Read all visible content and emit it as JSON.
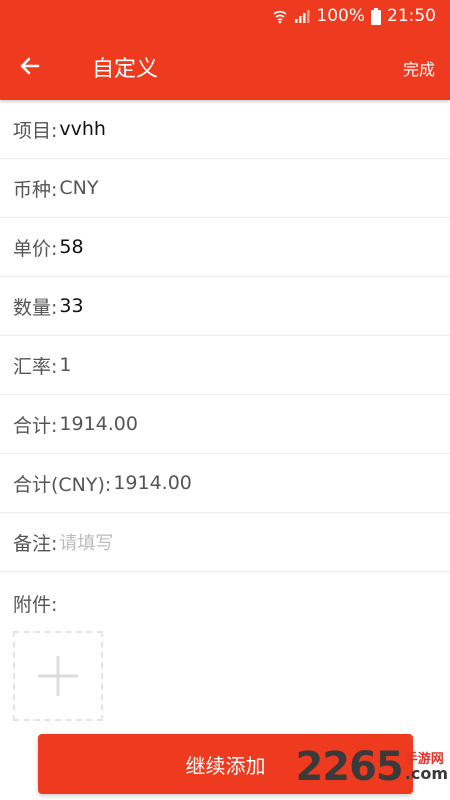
{
  "status_bar": {
    "battery": "100%",
    "time": "21:50",
    "icons": [
      "wifi-icon",
      "signal-icon",
      "battery-icon"
    ]
  },
  "appbar": {
    "back_icon": "arrow-left-icon",
    "title": "自定义",
    "done_label": "完成"
  },
  "form": {
    "item": {
      "label": "项目:",
      "value": "vvhh"
    },
    "currency": {
      "label": "币种:",
      "value": "CNY"
    },
    "unit_price": {
      "label": "单价:",
      "value": "58"
    },
    "quantity": {
      "label": "数量:",
      "value": "33"
    },
    "exchange_rate": {
      "label": "汇率:",
      "value": "1"
    },
    "total": {
      "label": "合计:",
      "value": "1914.00"
    },
    "total_cny": {
      "label": "合计(CNY):",
      "value": "1914.00"
    },
    "note": {
      "label": "备注:",
      "placeholder": "请填写"
    },
    "attachment": {
      "label": "附件:",
      "add_icon": "plus-icon"
    }
  },
  "continue_button": {
    "label": "继续添加"
  },
  "watermark": {
    "digits": "2265",
    "tag": "手游网",
    "domain": ".com"
  },
  "colors": {
    "accent": "#ee3a1f",
    "divider": "#ececec",
    "placeholder": "#bbbbbb"
  }
}
